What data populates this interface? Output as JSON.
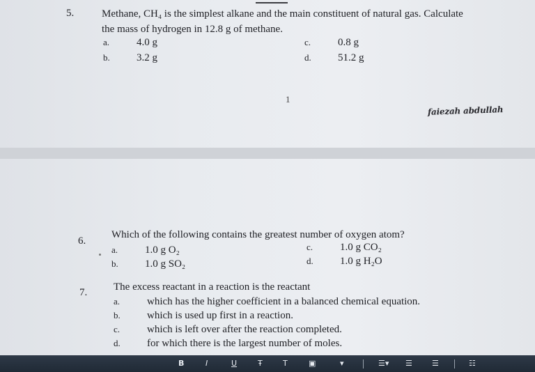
{
  "page1": {
    "q5": {
      "number": "5.",
      "line1": "Methane, CH₄ is the simplest alkane and the main constituent of natural gas. Calculate",
      "line2": "the mass of hydrogen in 12.8 g of methane.",
      "options": [
        {
          "letter": "a.",
          "text": "4.0 g"
        },
        {
          "letter": "b.",
          "text": "3.2 g"
        },
        {
          "letter": "c.",
          "text": "0.8 g"
        },
        {
          "letter": "d.",
          "text": "51.2 g"
        }
      ]
    },
    "page_number": "1",
    "signature": "faiezah abdullah"
  },
  "page2": {
    "q6": {
      "number": "6.",
      "text": "Which of the following contains the greatest number of oxygen atom?",
      "options": [
        {
          "letter": "a.",
          "text": "1.0 g O₂"
        },
        {
          "letter": "b.",
          "text": "1.0 g SO₂"
        },
        {
          "letter": "c.",
          "text": "1.0 g CO₂"
        },
        {
          "letter": "d.",
          "text": "1.0 g H₂O"
        }
      ]
    },
    "q7": {
      "number": "7.",
      "text": "The excess reactant in a reaction is the reactant",
      "options": [
        {
          "letter": "a.",
          "text": "which has the higher coefficient in a balanced chemical equation."
        },
        {
          "letter": "b.",
          "text": "which is used up first in a reaction."
        },
        {
          "letter": "c.",
          "text": "which is left over after the reaction completed."
        },
        {
          "letter": "d.",
          "text": "for which there is the largest number of moles."
        }
      ]
    }
  },
  "toolbar": {
    "icons": [
      "bold-icon",
      "italic-icon",
      "underline-icon",
      "strikethrough-icon",
      "text-color-icon",
      "highlight-icon",
      "dropdown-icon",
      "line-spacing-icon",
      "align-left-icon",
      "align-center-icon",
      "align-right-icon"
    ],
    "glyphs": {
      "bold": "B",
      "italic": "I",
      "underline": "U",
      "strike": "Ŧ",
      "text": "T",
      "highlight": "▣",
      "dropdown": "▾",
      "spacing": "☰▾",
      "left": "☰",
      "center": "☰",
      "right": "☷"
    }
  }
}
